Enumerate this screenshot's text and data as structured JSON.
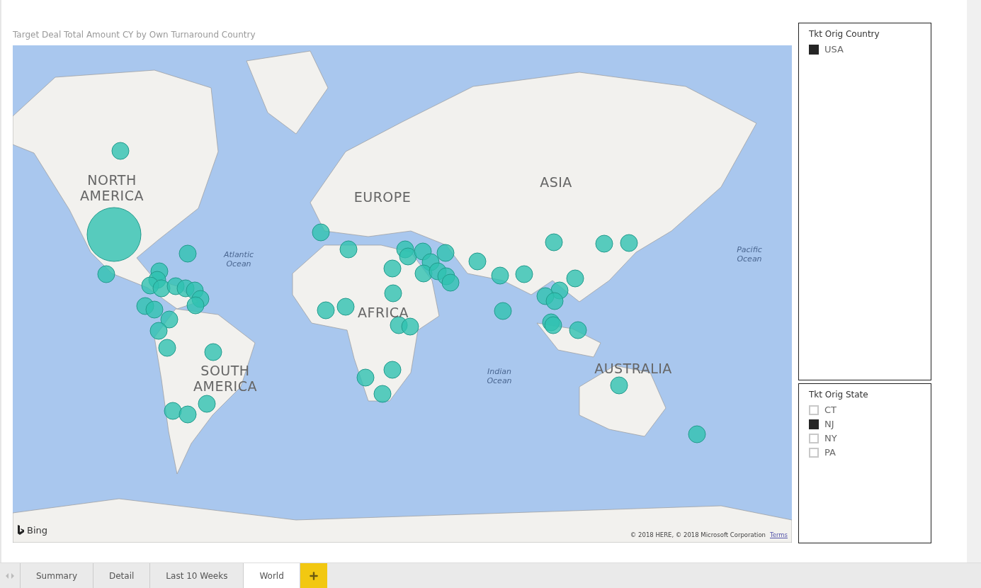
{
  "report": {
    "title": "Target Deal Total Amount CY by Own Turnaround Country"
  },
  "map": {
    "labels": [
      {
        "kind": "continent",
        "text": "NORTH AMERICA"
      },
      {
        "kind": "continent",
        "text": "EUROPE"
      },
      {
        "kind": "continent",
        "text": "ASIA"
      },
      {
        "kind": "continent",
        "text": "AFRICA"
      },
      {
        "kind": "continent",
        "text": "SOUTH AMERICA"
      },
      {
        "kind": "continent",
        "text": "AUSTRALIA"
      },
      {
        "kind": "ocean",
        "text": "Atlantic Ocean"
      },
      {
        "kind": "ocean",
        "text": "Pacific Ocean"
      },
      {
        "kind": "ocean",
        "text": "Indian Ocean"
      }
    ],
    "provider": "Bing",
    "attribution": "© 2018 HERE, © 2018 Microsoft Corporation",
    "terms_link": "Terms"
  },
  "slicers": [
    {
      "title": "Tkt Orig Country",
      "items": [
        {
          "label": "USA",
          "checked": true
        }
      ]
    },
    {
      "title": "Tkt Orig State",
      "items": [
        {
          "label": "CT",
          "checked": false
        },
        {
          "label": "NJ",
          "checked": true
        },
        {
          "label": "NY",
          "checked": false
        },
        {
          "label": "PA",
          "checked": false
        }
      ]
    }
  ],
  "tabs": [
    {
      "label": "Summary",
      "selected": false
    },
    {
      "label": "Detail",
      "selected": false
    },
    {
      "label": "Last 10 Weeks",
      "selected": false
    },
    {
      "label": "World",
      "selected": true
    }
  ]
}
